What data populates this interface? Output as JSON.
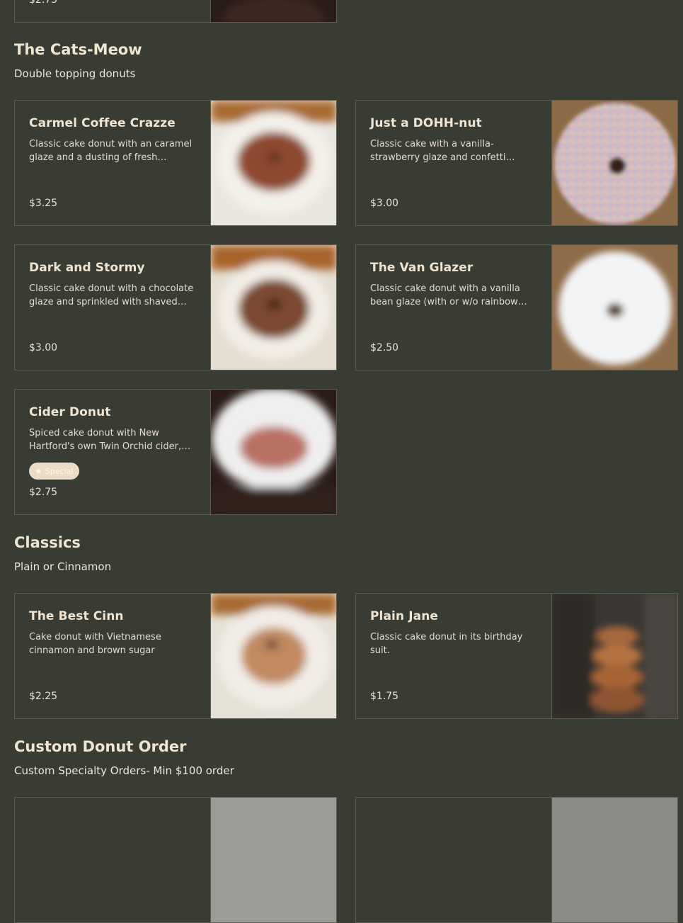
{
  "top_partial_price": "$2.75",
  "sections": [
    {
      "title": "The Cats-Meow",
      "subtitle": "Double topping donuts",
      "items": [
        {
          "name": "Carmel Coffee Crazze",
          "desc": "Classic cake donut with an caramel glaze and a dusting of fresh espresso.",
          "price": "$3.25"
        },
        {
          "name": "Just a DOHH-nut",
          "desc": "Classic cake with a vanilla-strawberry glaze and confetti sprinkles.",
          "price": "$3.00"
        },
        {
          "name": "Dark and Stormy",
          "desc": "Classic cake donut with a chocolate glaze and sprinkled with shaved coconut.",
          "price": "$3.00"
        },
        {
          "name": "The Van Glazer",
          "desc": "Classic cake donut with a vanilla bean glaze (with or w/o rainbow sprinkles)",
          "price": "$2.50"
        },
        {
          "name": "Cider Donut",
          "desc": "Spiced cake donut with New Hartford's own Twin Orchid cider, rolled in cinnamon sugar.",
          "price": "$2.75",
          "badge": "Special"
        }
      ]
    },
    {
      "title": "Classics",
      "subtitle": "Plain or Cinnamon",
      "items": [
        {
          "name": "The Best Cinn",
          "desc": "Cake donut with Vietnamese cinnamon and brown sugar",
          "price": "$2.25"
        },
        {
          "name": "Plain Jane",
          "desc": "Classic cake donut in its birthday suit.",
          "price": "$1.75"
        }
      ]
    },
    {
      "title": "Custom Donut Order",
      "subtitle": "Custom Specialty Orders- Min $100 order"
    }
  ]
}
